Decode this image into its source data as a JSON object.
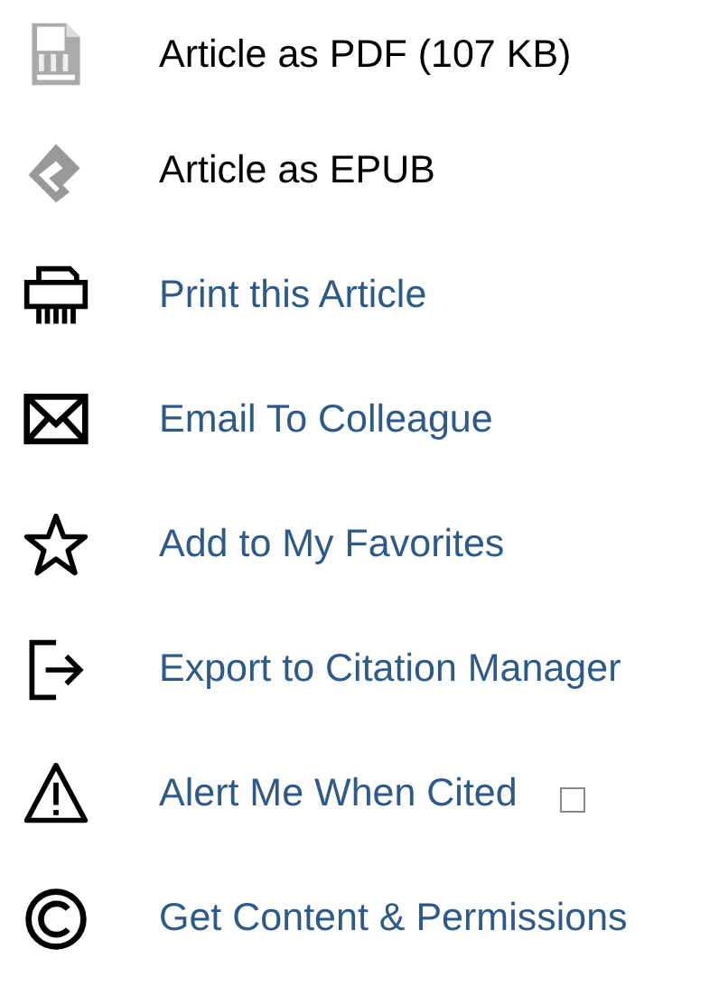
{
  "items": [
    {
      "label": "Article as PDF (107 KB)",
      "kind": "text"
    },
    {
      "label": "Article as EPUB",
      "kind": "text"
    },
    {
      "label": "Print this Article",
      "kind": "link"
    },
    {
      "label": "Email To Colleague",
      "kind": "link"
    },
    {
      "label": "Add to My Favorites",
      "kind": "link"
    },
    {
      "label": "Export to Citation Manager",
      "kind": "link"
    },
    {
      "label": "Alert Me When Cited",
      "kind": "link",
      "checkbox": {
        "checked": false
      }
    },
    {
      "label": "Get Content & Permissions",
      "kind": "link"
    }
  ]
}
